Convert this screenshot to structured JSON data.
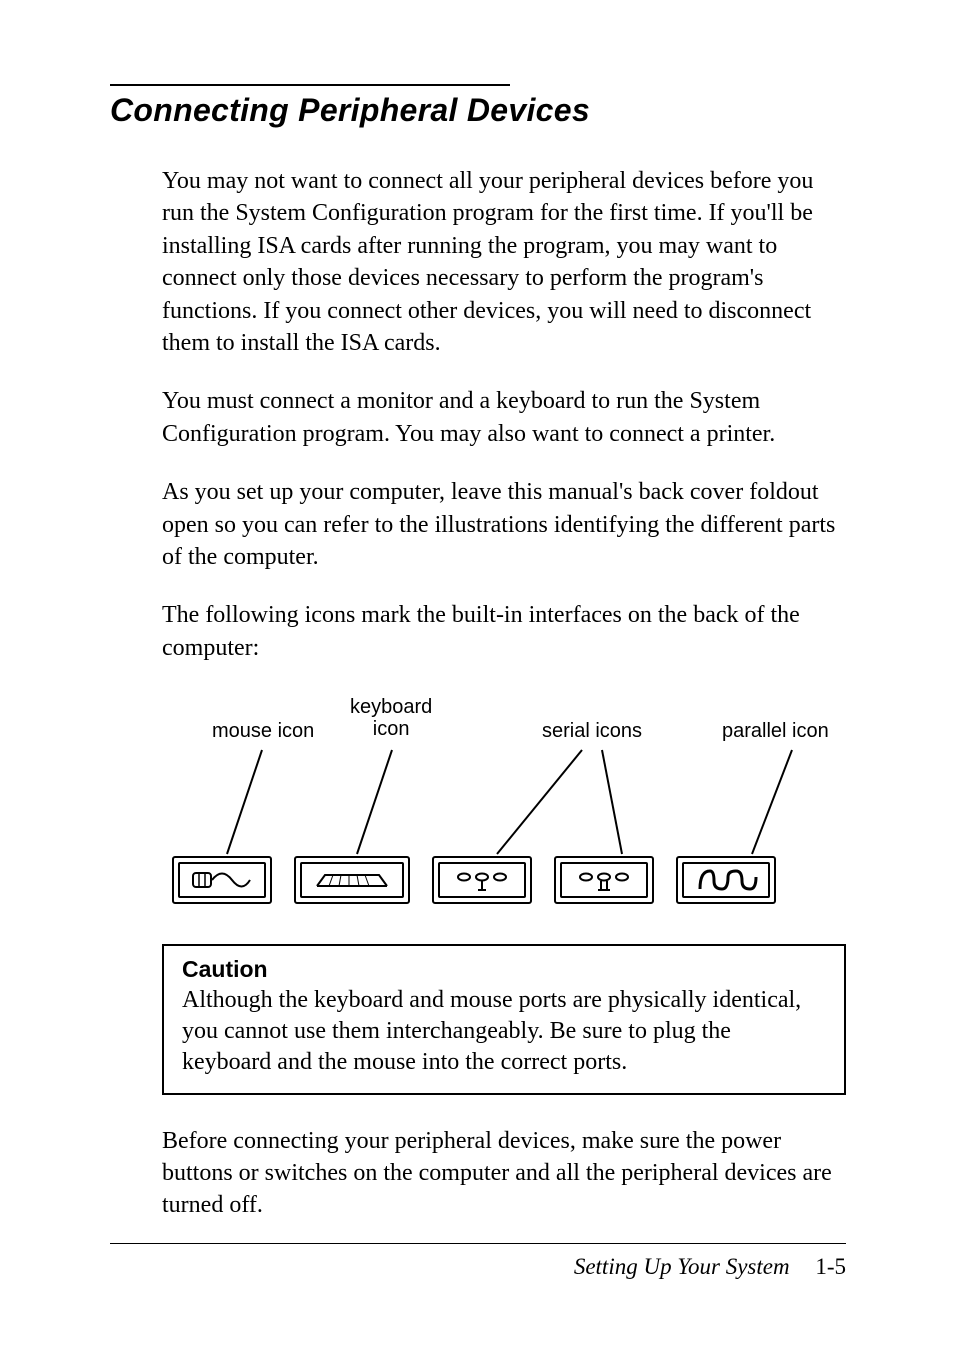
{
  "title": "Connecting Peripheral Devices",
  "paragraphs": {
    "p1": "You may not want to connect all your peripheral devices before you run the System Configuration program for the first time. If you'll be installing ISA cards after running the program, you may want to connect only those devices necessary to perform the program's functions. If you connect other devices, you will need to disconnect them to install the ISA cards.",
    "p2": "You must connect a monitor and a keyboard to run the System Configuration program. You may also want to connect a printer.",
    "p3": "As you set up your computer, leave this manual's back cover foldout open so you can refer to the illustrations identifying the different parts of the computer.",
    "p4": "The following icons mark the built-in interfaces on the back of the  computer:"
  },
  "figure": {
    "labels": {
      "mouse": "mouse icon",
      "keyboard_line1": "keyboard",
      "keyboard_line2": "icon",
      "serial": "serial icons",
      "parallel": "parallel icon"
    }
  },
  "caution": {
    "title": "Caution",
    "text": "Although the keyboard and mouse ports are physically identical, you cannot use them interchangeably. Be sure to plug the keyboard and the mouse into the correct ports."
  },
  "closing": "Before connecting your peripheral devices, make sure the power buttons or switches on the computer and all the peripheral devices are turned off.",
  "footer": {
    "section": "Setting Up Your System",
    "page": "1-5"
  }
}
